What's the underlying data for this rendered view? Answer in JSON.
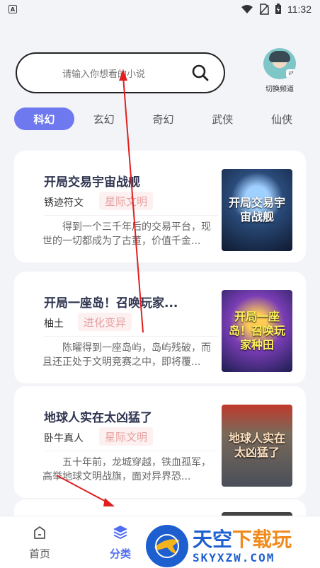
{
  "status_bar": {
    "app_icon_letter": "A",
    "time": "11:32"
  },
  "search": {
    "placeholder": "请输入你想看的小说"
  },
  "channel_switch": {
    "label": "切换频道"
  },
  "tabs": [
    {
      "label": "科幻",
      "active": true
    },
    {
      "label": "玄幻",
      "active": false
    },
    {
      "label": "奇幻",
      "active": false
    },
    {
      "label": "武侠",
      "active": false
    },
    {
      "label": "仙侠",
      "active": false
    }
  ],
  "books": [
    {
      "title": "开局交易宇宙战舰",
      "author": "锈迹符文",
      "tag": "星际文明",
      "description": "得到一个三千年后的交易平台，现世的一切都成为了古董，价值千金...",
      "cover_text": "开局交易宇宙战舰"
    },
    {
      "title": "开局一座岛！召唤玩家...",
      "author": "柚土",
      "tag": "进化变异",
      "description": "陈曜得到一座岛屿，岛屿残破，而且还正处于文明竞赛之中，即将覆...",
      "cover_text": "开局一座岛！召唤玩家种田"
    },
    {
      "title": "地球人实在太凶猛了",
      "author": "卧牛真人",
      "tag": "星际文明",
      "description": "五十年前，龙城穿越，铁血孤军，高举地球文明战旗，面对异界恐...",
      "cover_text": "地球人实在太凶猛了"
    }
  ],
  "bottom_nav": {
    "home_label": "首页",
    "category_label": "分类"
  },
  "watermark": {
    "cn_main": "天空",
    "cn_accent": "下载玩",
    "en": "SKYXZW.COM"
  },
  "colors": {
    "accent": "#6e79f0",
    "nav_active": "#4f6df0",
    "tag_bg": "#fdf0f0",
    "tag_text": "#e7a1a1",
    "arrow": "#e02020"
  }
}
